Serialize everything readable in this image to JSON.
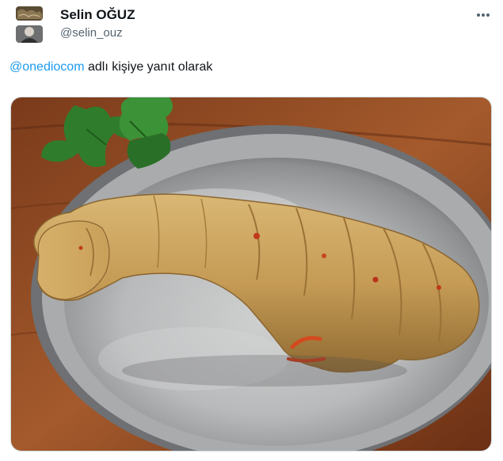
{
  "tweet": {
    "display_name": "Selin OĞUZ",
    "handle": "@selin_ouz",
    "reply_mention": "@onediocom",
    "reply_suffix": " adlı kişiye yanıt olarak"
  },
  "icons": {
    "more": "more-horizontal-icon"
  },
  "colors": {
    "link": "#1d9bf0",
    "secondary_text": "#536471",
    "primary_text": "#0f1419"
  }
}
